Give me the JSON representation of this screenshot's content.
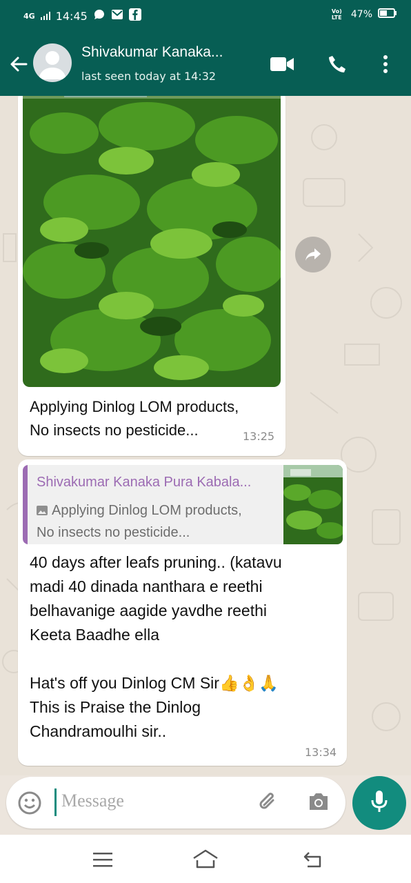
{
  "status_bar": {
    "network": "4G",
    "time": "14:45",
    "volte": "Vo) LTE",
    "battery": "47%"
  },
  "header": {
    "contact_name": "Shivakumar Kanaka...",
    "last_seen": "last seen today at 14:32",
    "icons": [
      "back-arrow-icon",
      "avatar",
      "video-call-icon",
      "phone-icon",
      "more-options-icon"
    ]
  },
  "messages": [
    {
      "type": "image",
      "caption": "Applying Dinlog LOM products,\nNo insects no pesticide...",
      "time": "13:25"
    },
    {
      "type": "reply",
      "quote_name": "Shivakumar Kanaka Pura Kabala...",
      "quote_text": "Applying Dinlog LOM products,\nNo insects no pesticide...",
      "text": "40 days after leafs pruning.. (katavu\nmadi 40 dinada nanthara e reethi\nbelhavanige aagide yavdhe reethi\nKeeta Baadhe ella\n\nHat's off you Dinlog CM Sir👍👌🙏\nThis is Praise the Dinlog\nChandramoulhi sir..",
      "time": "13:34"
    }
  ],
  "input": {
    "placeholder": "Message"
  },
  "colors": {
    "header": "#075e54",
    "accent": "#128c7e",
    "chat_bg": "#e9e2d8",
    "quote_name": "#9c6bb3"
  }
}
